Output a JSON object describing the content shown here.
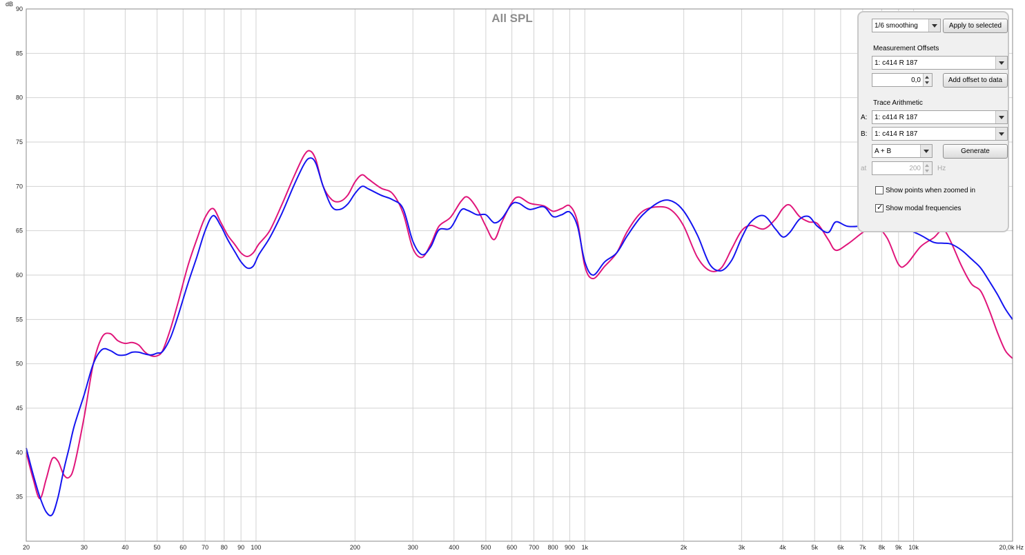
{
  "chart_data": {
    "type": "line",
    "title": "All SPL",
    "ylabel": "dB",
    "xunit": "Hz",
    "xscale": "log",
    "xlim": [
      20,
      20000
    ],
    "ylim": [
      30,
      90
    ],
    "grid": true,
    "y_ticks": [
      "35",
      "40",
      "45",
      "50",
      "55",
      "60",
      "65",
      "70",
      "75",
      "80",
      "85",
      "90"
    ],
    "y_tick_values": [
      35,
      40,
      45,
      50,
      55,
      60,
      65,
      70,
      75,
      80,
      85,
      90
    ],
    "x_ticks": [
      {
        "f": 20,
        "label": "20"
      },
      {
        "f": 30,
        "label": "30"
      },
      {
        "f": 40,
        "label": "40"
      },
      {
        "f": 50,
        "label": "50"
      },
      {
        "f": 60,
        "label": "60"
      },
      {
        "f": 70,
        "label": "70"
      },
      {
        "f": 80,
        "label": "80"
      },
      {
        "f": 90,
        "label": "90"
      },
      {
        "f": 100,
        "label": "100"
      },
      {
        "f": 200,
        "label": "200"
      },
      {
        "f": 300,
        "label": "300"
      },
      {
        "f": 400,
        "label": "400"
      },
      {
        "f": 500,
        "label": "500"
      },
      {
        "f": 600,
        "label": "600"
      },
      {
        "f": 700,
        "label": "700"
      },
      {
        "f": 800,
        "label": "800"
      },
      {
        "f": 900,
        "label": "900"
      },
      {
        "f": 1000,
        "label": "1k"
      },
      {
        "f": 2000,
        "label": "2k"
      },
      {
        "f": 3000,
        "label": "3k"
      },
      {
        "f": 4000,
        "label": "4k"
      },
      {
        "f": 5000,
        "label": "5k"
      },
      {
        "f": 6000,
        "label": "6k"
      },
      {
        "f": 7000,
        "label": "7k"
      },
      {
        "f": 8000,
        "label": "8k"
      },
      {
        "f": 9000,
        "label": "9k"
      },
      {
        "f": 10000,
        "label": "10k"
      },
      {
        "f": 20000,
        "label": "20,0k Hz"
      }
    ],
    "series": [
      {
        "color": "#e0157a",
        "points": [
          [
            20,
            40
          ],
          [
            21,
            37
          ],
          [
            22,
            34.8
          ],
          [
            23,
            37
          ],
          [
            24,
            39.3
          ],
          [
            25,
            39
          ],
          [
            26,
            37.5
          ],
          [
            27,
            37.2
          ],
          [
            28,
            38.5
          ],
          [
            30,
            44
          ],
          [
            32,
            50
          ],
          [
            34,
            53
          ],
          [
            36,
            53.4
          ],
          [
            38,
            52.6
          ],
          [
            40,
            52.3
          ],
          [
            42,
            52.4
          ],
          [
            44,
            52.1
          ],
          [
            46,
            51.3
          ],
          [
            48,
            50.9
          ],
          [
            50,
            50.9
          ],
          [
            52,
            51.5
          ],
          [
            55,
            54
          ],
          [
            58,
            57
          ],
          [
            62,
            61
          ],
          [
            66,
            64
          ],
          [
            70,
            66.5
          ],
          [
            74,
            67.5
          ],
          [
            78,
            66
          ],
          [
            82,
            64.5
          ],
          [
            86,
            63.5
          ],
          [
            90,
            62.5
          ],
          [
            94,
            62.1
          ],
          [
            98,
            62.5
          ],
          [
            102,
            63.5
          ],
          [
            110,
            65
          ],
          [
            120,
            68
          ],
          [
            130,
            71
          ],
          [
            140,
            73.5
          ],
          [
            146,
            74
          ],
          [
            152,
            73
          ],
          [
            160,
            70
          ],
          [
            170,
            68.5
          ],
          [
            180,
            68.3
          ],
          [
            190,
            69
          ],
          [
            200,
            70.5
          ],
          [
            210,
            71.3
          ],
          [
            220,
            70.8
          ],
          [
            240,
            69.8
          ],
          [
            260,
            69.2
          ],
          [
            280,
            67
          ],
          [
            300,
            63
          ],
          [
            320,
            62
          ],
          [
            340,
            63.5
          ],
          [
            360,
            65.5
          ],
          [
            390,
            66.5
          ],
          [
            420,
            68.3
          ],
          [
            440,
            68.8
          ],
          [
            470,
            67.5
          ],
          [
            500,
            65.5
          ],
          [
            530,
            64
          ],
          [
            560,
            66
          ],
          [
            600,
            68.2
          ],
          [
            630,
            68.8
          ],
          [
            680,
            68.1
          ],
          [
            750,
            67.8
          ],
          [
            800,
            67.2
          ],
          [
            850,
            67.5
          ],
          [
            900,
            67.8
          ],
          [
            950,
            66
          ],
          [
            1000,
            61
          ],
          [
            1060,
            59.6
          ],
          [
            1150,
            61
          ],
          [
            1250,
            62.5
          ],
          [
            1350,
            65
          ],
          [
            1500,
            67.2
          ],
          [
            1700,
            67.7
          ],
          [
            1850,
            67.2
          ],
          [
            2000,
            65.5
          ],
          [
            2200,
            62
          ],
          [
            2400,
            60.5
          ],
          [
            2600,
            60.8
          ],
          [
            2800,
            63
          ],
          [
            3000,
            65
          ],
          [
            3200,
            65.6
          ],
          [
            3500,
            65.2
          ],
          [
            3800,
            66.3
          ],
          [
            4000,
            67.5
          ],
          [
            4200,
            67.9
          ],
          [
            4500,
            66.6
          ],
          [
            4800,
            66
          ],
          [
            5100,
            65.8
          ],
          [
            5500,
            64
          ],
          [
            5800,
            62.8
          ],
          [
            6300,
            63.5
          ],
          [
            7000,
            64.8
          ],
          [
            7600,
            65.6
          ],
          [
            8300,
            64.2
          ],
          [
            9000,
            61.2
          ],
          [
            9500,
            61.2
          ],
          [
            10500,
            63.2
          ],
          [
            11500,
            64.2
          ],
          [
            12300,
            65.1
          ],
          [
            13000,
            63.7
          ],
          [
            14000,
            61
          ],
          [
            15000,
            59
          ],
          [
            16000,
            58.2
          ],
          [
            17000,
            56
          ],
          [
            18000,
            53.5
          ],
          [
            19000,
            51.5
          ],
          [
            20000,
            50.6
          ]
        ]
      },
      {
        "color": "#1414f0",
        "points": [
          [
            20,
            40.5
          ],
          [
            21,
            37.5
          ],
          [
            22,
            35
          ],
          [
            23,
            33.3
          ],
          [
            24,
            33
          ],
          [
            25,
            35
          ],
          [
            26,
            38
          ],
          [
            27,
            40.5
          ],
          [
            28,
            43
          ],
          [
            30,
            46.5
          ],
          [
            32,
            50
          ],
          [
            34,
            51.6
          ],
          [
            36,
            51.5
          ],
          [
            38,
            51
          ],
          [
            40,
            51
          ],
          [
            42,
            51.3
          ],
          [
            44,
            51.3
          ],
          [
            46,
            51.1
          ],
          [
            48,
            51
          ],
          [
            50,
            51.2
          ],
          [
            52,
            51.4
          ],
          [
            55,
            53
          ],
          [
            58,
            55.5
          ],
          [
            62,
            59
          ],
          [
            66,
            62
          ],
          [
            70,
            65
          ],
          [
            74,
            66.7
          ],
          [
            78,
            65.6
          ],
          [
            82,
            64
          ],
          [
            86,
            62.7
          ],
          [
            90,
            61.5
          ],
          [
            94,
            60.8
          ],
          [
            98,
            61
          ],
          [
            102,
            62.3
          ],
          [
            110,
            64.2
          ],
          [
            120,
            67
          ],
          [
            130,
            70
          ],
          [
            140,
            72.5
          ],
          [
            146,
            73.2
          ],
          [
            152,
            72.6
          ],
          [
            160,
            70
          ],
          [
            170,
            67.7
          ],
          [
            180,
            67.4
          ],
          [
            190,
            68
          ],
          [
            200,
            69.2
          ],
          [
            210,
            70
          ],
          [
            220,
            69.7
          ],
          [
            240,
            69
          ],
          [
            260,
            68.5
          ],
          [
            280,
            67.5
          ],
          [
            300,
            63.8
          ],
          [
            320,
            62.3
          ],
          [
            340,
            63.2
          ],
          [
            360,
            65.1
          ],
          [
            390,
            65.3
          ],
          [
            420,
            67.3
          ],
          [
            440,
            67.3
          ],
          [
            470,
            66.8
          ],
          [
            500,
            66.8
          ],
          [
            530,
            65.9
          ],
          [
            560,
            66.4
          ],
          [
            600,
            68
          ],
          [
            630,
            68.1
          ],
          [
            680,
            67.4
          ],
          [
            750,
            67.7
          ],
          [
            800,
            66.6
          ],
          [
            850,
            66.8
          ],
          [
            900,
            67.1
          ],
          [
            950,
            65.5
          ],
          [
            1000,
            61.5
          ],
          [
            1060,
            60
          ],
          [
            1150,
            61.5
          ],
          [
            1250,
            62.5
          ],
          [
            1350,
            64.5
          ],
          [
            1500,
            66.8
          ],
          [
            1700,
            68.3
          ],
          [
            1850,
            68.3
          ],
          [
            2000,
            67.2
          ],
          [
            2200,
            64.5
          ],
          [
            2400,
            61.2
          ],
          [
            2600,
            60.5
          ],
          [
            2800,
            61.7
          ],
          [
            3000,
            64.2
          ],
          [
            3200,
            66
          ],
          [
            3500,
            66.7
          ],
          [
            3800,
            65.2
          ],
          [
            4000,
            64.3
          ],
          [
            4200,
            64.8
          ],
          [
            4500,
            66.3
          ],
          [
            4800,
            66.6
          ],
          [
            5100,
            65.5
          ],
          [
            5500,
            64.8
          ],
          [
            5800,
            66
          ],
          [
            6300,
            65.5
          ],
          [
            7000,
            65.6
          ],
          [
            7600,
            66.2
          ],
          [
            8300,
            66
          ],
          [
            9000,
            65.5
          ],
          [
            9500,
            65.2
          ],
          [
            10500,
            64.5
          ],
          [
            11500,
            63.7
          ],
          [
            12300,
            63.6
          ],
          [
            13000,
            63.5
          ],
          [
            14000,
            62.8
          ],
          [
            15000,
            61.8
          ],
          [
            16000,
            60.8
          ],
          [
            17000,
            59.3
          ],
          [
            18000,
            57.8
          ],
          [
            19000,
            56.2
          ],
          [
            20000,
            55
          ]
        ]
      }
    ]
  },
  "panel": {
    "smoothing": "1/6 smoothing",
    "apply_label": "Apply to selected",
    "offsets_title": "Measurement Offsets",
    "offset_measurement": "1: c414 R 187",
    "offset_value": "0,0",
    "add_offset_label": "Add offset to data",
    "arith_title": "Trace Arithmetic",
    "a_label": "A:",
    "a_value": "1: c414 R 187",
    "b_label": "B:",
    "b_value": "1: c414 R 187",
    "operation": "A + B",
    "generate_label": "Generate",
    "at_label": "at",
    "at_value": "200",
    "at_unit": "Hz",
    "show_points_label": "Show points when zoomed in",
    "show_points_checked": false,
    "show_modal_label": "Show modal frequencies",
    "show_modal_checked": true
  }
}
